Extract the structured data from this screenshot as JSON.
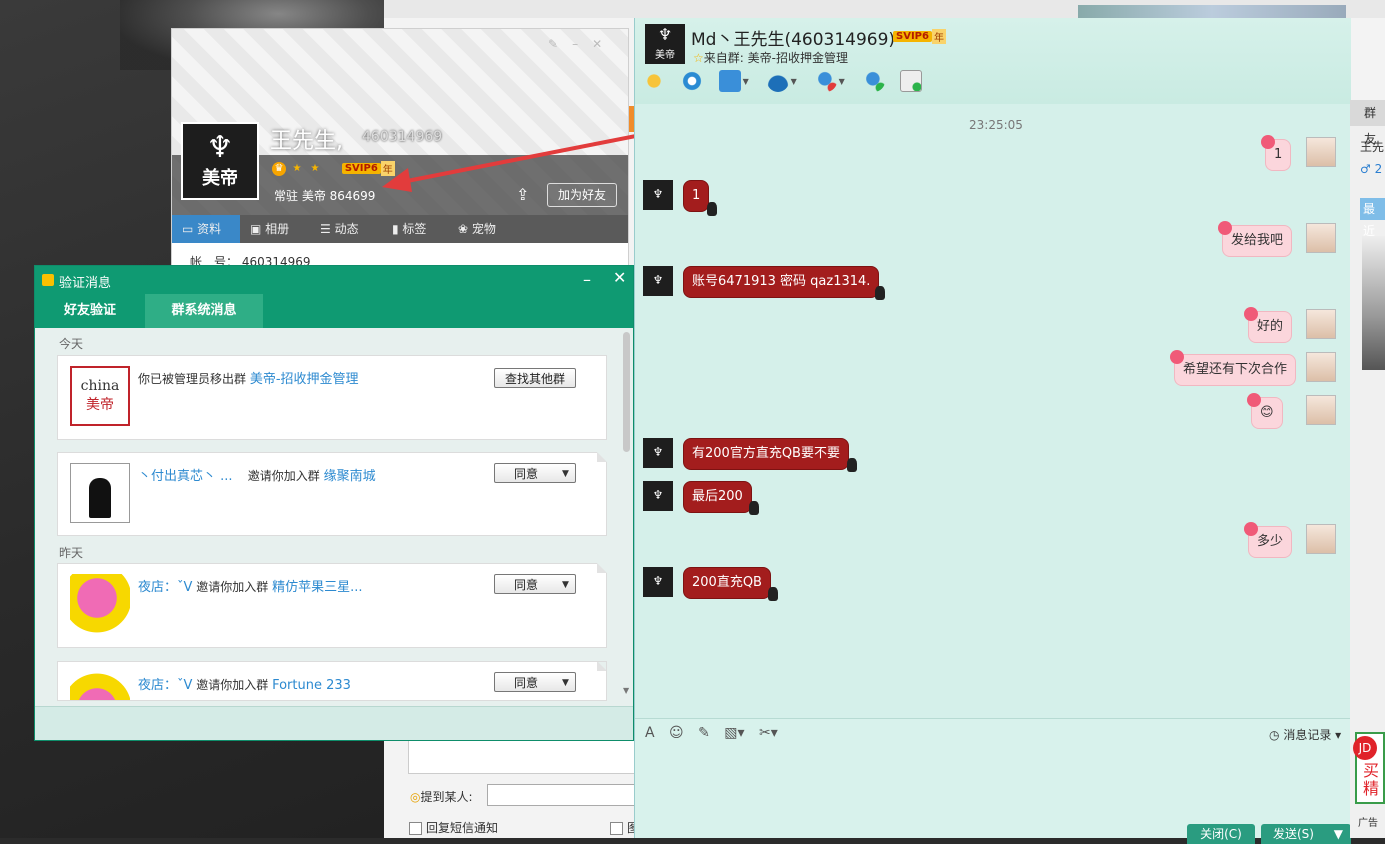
{
  "profile": {
    "name": "王先生,",
    "qq": "460314969",
    "avatar_label": "美帝",
    "vip": "SVIP6",
    "vip_year": "年",
    "resident": "常驻 美帝 864699",
    "add_friend": "加为好友",
    "tabs": [
      "资料",
      "相册",
      "动态",
      "标签",
      "宠物"
    ],
    "row_label": "帐　号：",
    "row_value": "460314969"
  },
  "verify": {
    "title": "验证消息",
    "tabs": [
      "好友验证",
      "群系统消息"
    ],
    "days": [
      "今天",
      "昨天"
    ],
    "items": [
      {
        "text": "你已被管理员移出群",
        "link": "美帝-招收押金管理",
        "button": "查找其他群",
        "thumb_line1": "china",
        "thumb_line2": "美帝"
      },
      {
        "user": "丶付出真芯丶 ...",
        "text": "邀请你加入群",
        "link": "缘聚南城",
        "button": "同意"
      },
      {
        "user": "夜店：ˇV",
        "text": "邀请你加入群",
        "link": "精仿苹果三星...",
        "button": "同意"
      },
      {
        "user": "夜店：ˇV",
        "text": "邀请你加入群",
        "link": "Fortune 233",
        "button": "同意"
      }
    ]
  },
  "behind": {
    "mention_label": "提到某人:",
    "sms_label": "回复短信通知",
    "cb2_label": "图"
  },
  "chat": {
    "title": "Md丶王先生(460314969)",
    "vip": "SVIP6",
    "vip_year": "年",
    "from_group": "来自群: 美帝-招收押金管理",
    "avatar_label": "美帝",
    "time": "23:25:05",
    "messages": [
      {
        "side": "me",
        "text": "1"
      },
      {
        "side": "them",
        "text": "1"
      },
      {
        "side": "me",
        "text": "发给我吧"
      },
      {
        "side": "them",
        "text": "账号6471913  密码 qaz1314."
      },
      {
        "side": "me",
        "text": "好的"
      },
      {
        "side": "me",
        "text": "希望还有下次合作"
      },
      {
        "side": "me",
        "text": "😊"
      },
      {
        "side": "them",
        "text": "有200官方直充QB要不要"
      },
      {
        "side": "them",
        "text": "最后200"
      },
      {
        "side": "me",
        "text": "多少"
      },
      {
        "side": "them",
        "text": "200直充QB"
      }
    ],
    "history": "消息记录",
    "close_btn": "关闭(C)",
    "send_btn": "发送(S)"
  },
  "side": {
    "header": "群友",
    "name": "王先",
    "gender": "♂ 2",
    "recent": "最近",
    "ad_jd": "JD",
    "ad_text": "买精",
    "ad_label": "广告"
  },
  "colors": {
    "accent_green": "#0f9a72",
    "bubble_red": "#a31d1d",
    "bubble_pink": "#fbd6dc",
    "link_blue": "#2d8ad0"
  }
}
